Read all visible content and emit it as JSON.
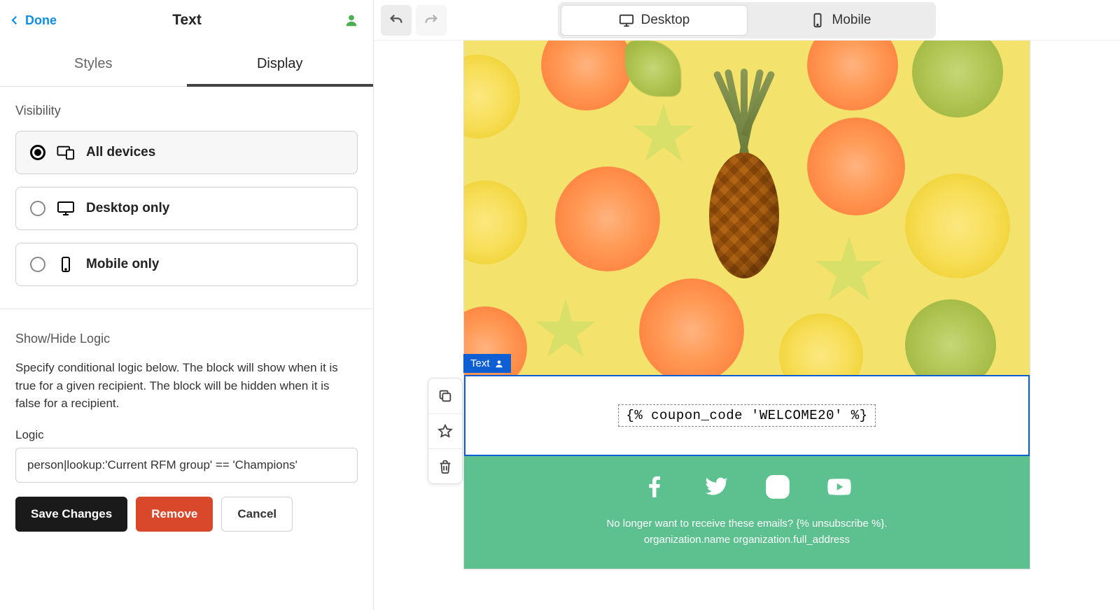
{
  "panel": {
    "done": "Done",
    "title": "Text",
    "tabs": {
      "styles": "Styles",
      "display": "Display"
    }
  },
  "visibility": {
    "heading": "Visibility",
    "options": {
      "all": "All devices",
      "desktop": "Desktop only",
      "mobile": "Mobile only"
    }
  },
  "logic": {
    "heading": "Show/Hide Logic",
    "description": "Specify conditional logic below. The block will show when it is true for a given recipient. The block will be hidden when it is false for a recipient.",
    "field_label": "Logic",
    "value": "person|lookup:'Current RFM group' == 'Champions'"
  },
  "buttons": {
    "save": "Save Changes",
    "remove": "Remove",
    "cancel": "Cancel"
  },
  "canvas": {
    "device_tabs": {
      "desktop": "Desktop",
      "mobile": "Mobile"
    },
    "block_tag": "Text",
    "coupon_tag": "{% coupon_code 'WELCOME20' %}",
    "footer_line1": "No longer want to receive these emails? {% unsubscribe %}.",
    "footer_line2": "organization.name organization.full_address"
  }
}
